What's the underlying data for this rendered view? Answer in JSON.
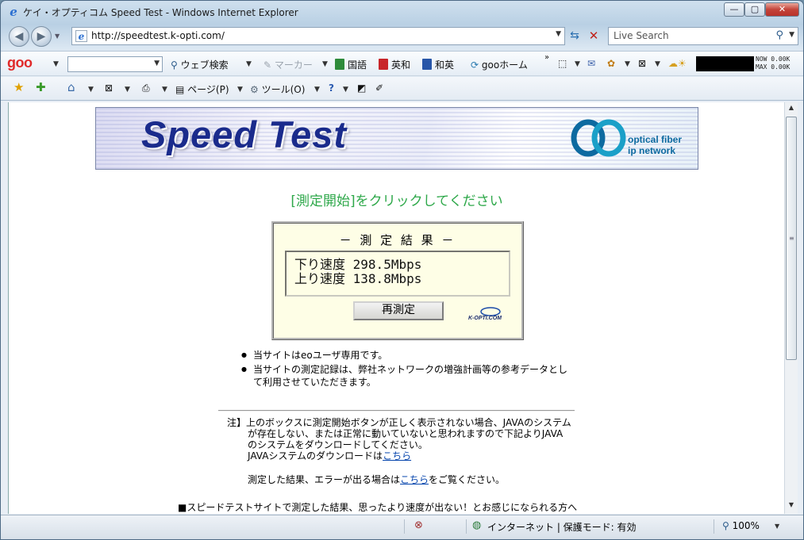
{
  "window": {
    "title": "ケイ・オプティコム Speed Test - Windows Internet Explorer",
    "minimize": "—",
    "maximize": "▢",
    "close": "✕"
  },
  "address_bar": {
    "url": "http://speedtest.k-opti.com/",
    "search_placeholder": "Live Search"
  },
  "goo_toolbar": {
    "logo": "goo",
    "search_button": "ウェブ検索",
    "marker": "マーカー",
    "kokugo": "国語",
    "eiwa": "英和",
    "waei": "和英",
    "home": "gooホーム",
    "meter_now": "NOW  0.00K",
    "meter_max": "MAX  0.00K"
  },
  "command_bar": {
    "page": "ページ(P)",
    "tools": "ツール(O)"
  },
  "page": {
    "banner_title": "Speed Test",
    "banner_sub1": "optical fiber",
    "banner_sub2": "ip network",
    "instruction": "[測定開始]をクリックしてください",
    "result_title": "－ 測 定 結 果 －",
    "down_label": "下り速度",
    "down_value": "298.5Mbps",
    "up_label": "上り速度",
    "up_value": "138.8Mbps",
    "retest_button": "再測定",
    "kopti_logo": "K-OPTI.COM",
    "bullets": [
      "当サイトはeoユーザ専用です。",
      "当サイトの測定記録は、弊社ネットワークの増強計画等の参考データとして利用させていただきます。"
    ],
    "note_line1": "注】上のボックスに測定開始ボタンが正しく表示されない場合、JAVAのシステム",
    "note_line2": "が存在しない、または正常に動いていないと思われますので下記よりJAVA",
    "note_line3": "のシステムをダウンロードしてください。",
    "note_line4": "JAVAシステムのダウンロードは",
    "link_here": "こちら",
    "note2_pre": "測定した結果、エラーが出る場合は",
    "note2_post": "をご覧ください。",
    "bottom_text": "■スピードテストサイトで測定した結果、思ったより速度が出ない！とお感じになられる方へ"
  },
  "status_bar": {
    "zone": "インターネット | 保護モード: 有効",
    "zoom": "100%"
  },
  "colors": {
    "instruction_green": "#2ea84a",
    "banner_blue": "#1a2b8c",
    "result_bg": "#fefee6"
  }
}
